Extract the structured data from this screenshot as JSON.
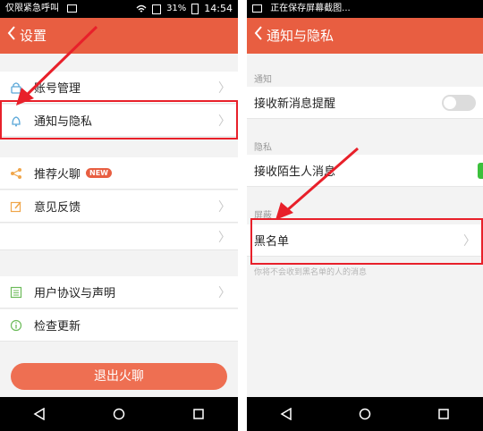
{
  "left": {
    "status": {
      "carrier": "仅限紧急呼叫",
      "battery": "31%",
      "time": "14:54"
    },
    "title": "设置",
    "rows": [
      {
        "label": "账号管理",
        "icon": "lock-icon"
      },
      {
        "label": "通知与隐私",
        "icon": "bell-icon"
      },
      {
        "label": "推荐火聊",
        "icon": "share-icon",
        "badge": "NEW"
      },
      {
        "label": "意见反馈",
        "icon": "edit-icon"
      },
      {
        "label": "用户协议与声明",
        "icon": "list-icon"
      },
      {
        "label": "检查更新",
        "icon": "info-icon"
      }
    ],
    "logout_label": "退出火聊"
  },
  "right": {
    "status": {
      "saving": "正在保存屏幕截图..."
    },
    "title": "通知与隐私",
    "sections": {
      "notify": "通知",
      "privacy": "隐私",
      "block": "屏蔽"
    },
    "rows": {
      "new_message": "接收新消息提醒",
      "stranger": "接收陌生人消息",
      "blacklist": "黑名单"
    },
    "blacklist_note": "你将不会收到黑名单的人的消息",
    "toggles": {
      "new_message": false,
      "stranger": true
    }
  },
  "colors": {
    "accent": "#e85e41",
    "highlight": "#e8202a",
    "toggle_on": "#3cc03c"
  }
}
